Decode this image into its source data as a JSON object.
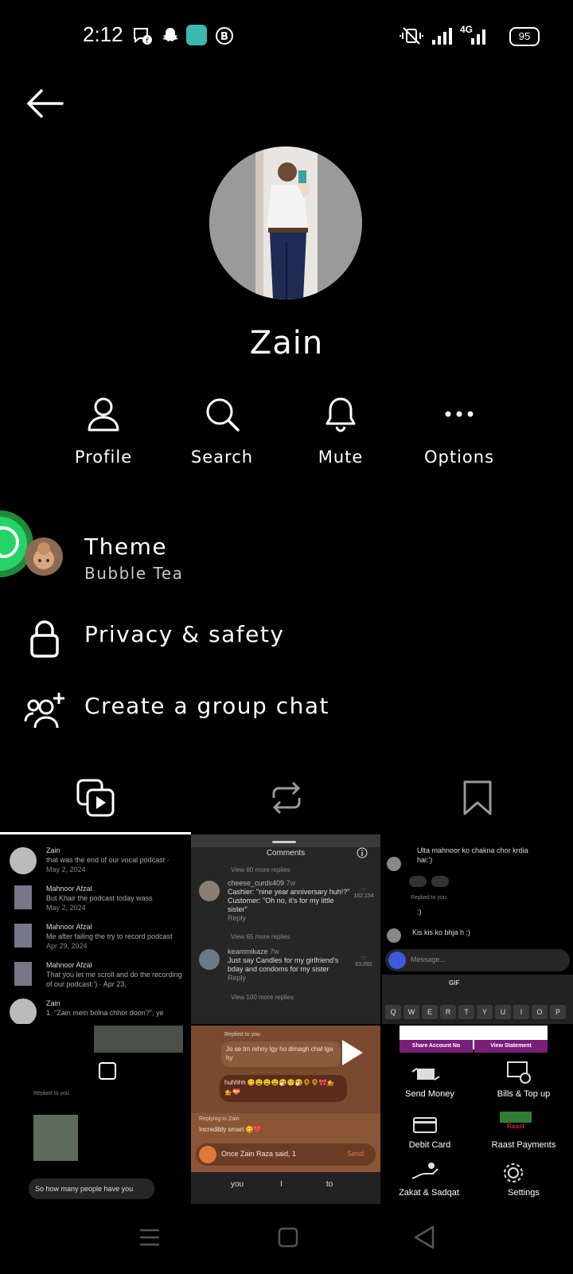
{
  "status": {
    "time": "2:12",
    "battery": "95",
    "network": "4G"
  },
  "contact": {
    "name": "Zain"
  },
  "actions": [
    {
      "label": "Profile",
      "icon": "person-icon"
    },
    {
      "label": "Search",
      "icon": "search-icon"
    },
    {
      "label": "Mute",
      "icon": "bell-icon"
    },
    {
      "label": "Options",
      "icon": "more-icon"
    }
  ],
  "menu": {
    "theme_title": "Theme",
    "theme_sub": "Bubble Tea",
    "privacy": "Privacy & safety",
    "group_chat": "Create a group chat"
  },
  "thumbs": {
    "t1": {
      "items": [
        {
          "name": "Zain",
          "text": "that was the end of our vocal podcast ·",
          "date": "May 2, 2024"
        },
        {
          "name": "Mahnoor Afzal",
          "text": "But Khair the podcast today wass",
          "date": "May 2, 2024"
        },
        {
          "name": "Mahnoor Afzal",
          "text": "Me after failing the try to record podcast",
          "date": "Apr 29, 2024"
        },
        {
          "name": "Mahnoor Afzal",
          "text": "That you let me scroll and do the recording of our podcast:') · Apr 23,",
          "date": ""
        },
        {
          "name": "Zain",
          "text": "1. \"Zain mein bolna chhor doon?\", ye",
          "date": ""
        }
      ]
    },
    "t2": {
      "title": "Comments",
      "view1": "View 60 more replies",
      "user1": "cheese_curds409",
      "when1": "7w",
      "c1": "Cashier: \"nine year anniversary huh!?\" Customer: \"Oh no, it's for my little sister\"",
      "likes1": "162,154",
      "view2": "View 65 more replies",
      "user2": "keammikaze",
      "when2": "7w",
      "c2": "Just say Candles for my girlfriend's bday and condoms for my sister",
      "likes2": "63,992",
      "view3": "View 100 more replies",
      "reply": "Reply"
    },
    "t3": {
      "m1": "Ulta mahnoor ko chakna chor krdia hai:')",
      "replied": "Replied to you",
      "m2": ":)",
      "m3": "Kis kis ko bhja h :)",
      "placeholder": "Message...",
      "gif": "GIF",
      "keys": [
        "Q",
        "W",
        "E",
        "R",
        "T",
        "Y",
        "U",
        "I",
        "O",
        "P"
      ]
    },
    "t4": {
      "replied": "Replied to you",
      "msg": "So how many people have you"
    },
    "t5": {
      "replied": "Replied to you",
      "m1": "Jo se tm rehny lgy ho dimagh chal lga hy",
      "m2": "huhhhh 😋😩😩😩🤧😚🤧🌻🌻🎀💁💁💝",
      "replying": "Replying to Zain",
      "quote": "Incredibly smart 😋❤️",
      "input": "Once Zain Raza said, 1",
      "send": "Send",
      "sugg": [
        "you",
        "I",
        "to"
      ]
    },
    "t6": {
      "share": "Share Account No",
      "statement": "View Statement",
      "items": [
        "Send Money",
        "Bills & Top up",
        "Debit Card",
        "Raast Payments",
        "Zakat & Sadqat",
        "Settings"
      ],
      "raast": "Raast"
    }
  },
  "colors": {
    "background": "#000000",
    "whatsapp": "#25d366",
    "bank_purple": "#7b1e7a",
    "raast_green": "#2e7d32"
  }
}
